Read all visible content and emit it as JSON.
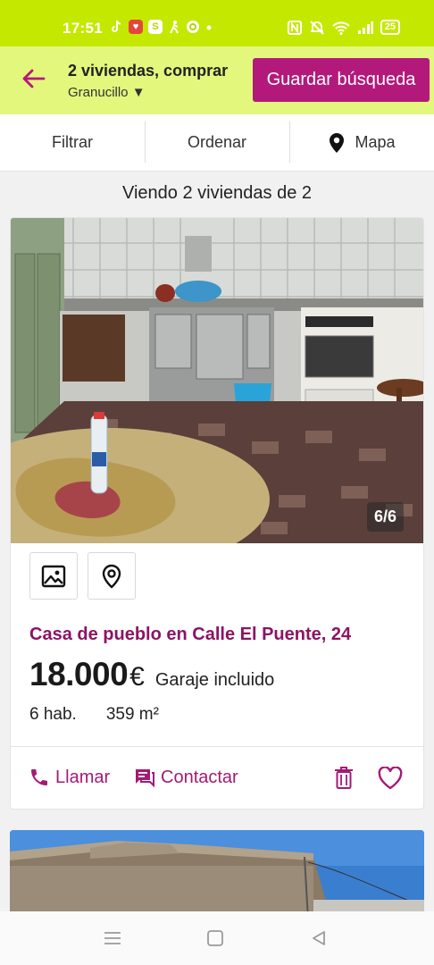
{
  "status_bar": {
    "time": "17:51",
    "battery": "25",
    "icons": [
      "tiktok-icon",
      "app-icon",
      "s-icon",
      "figure-icon",
      "q-icon",
      "dot-icon",
      "nfc-icon",
      "mute-icon",
      "wifi-icon",
      "signal-icon",
      "battery-icon"
    ]
  },
  "header": {
    "title": "2 viviendas, comprar",
    "location": "Granucillo ▼",
    "save_button": "Guardar búsqueda"
  },
  "toolbar": {
    "filter": "Filtrar",
    "sort": "Ordenar",
    "map": "Mapa"
  },
  "results_count": "Viendo 2 viviendas de 2",
  "listing": {
    "photo_counter": "6/6",
    "title": "Casa de pueblo en Calle El Puente, 24",
    "price": "18.000",
    "currency": "€",
    "extra": "Garaje incluido",
    "rooms": "6 hab.",
    "area": "359 m²",
    "call": "Llamar",
    "contact": "Contactar"
  },
  "colors": {
    "status_bar": "#c5e800",
    "header": "#e3f77c",
    "accent": "#b3197b",
    "title": "#8c1464"
  }
}
